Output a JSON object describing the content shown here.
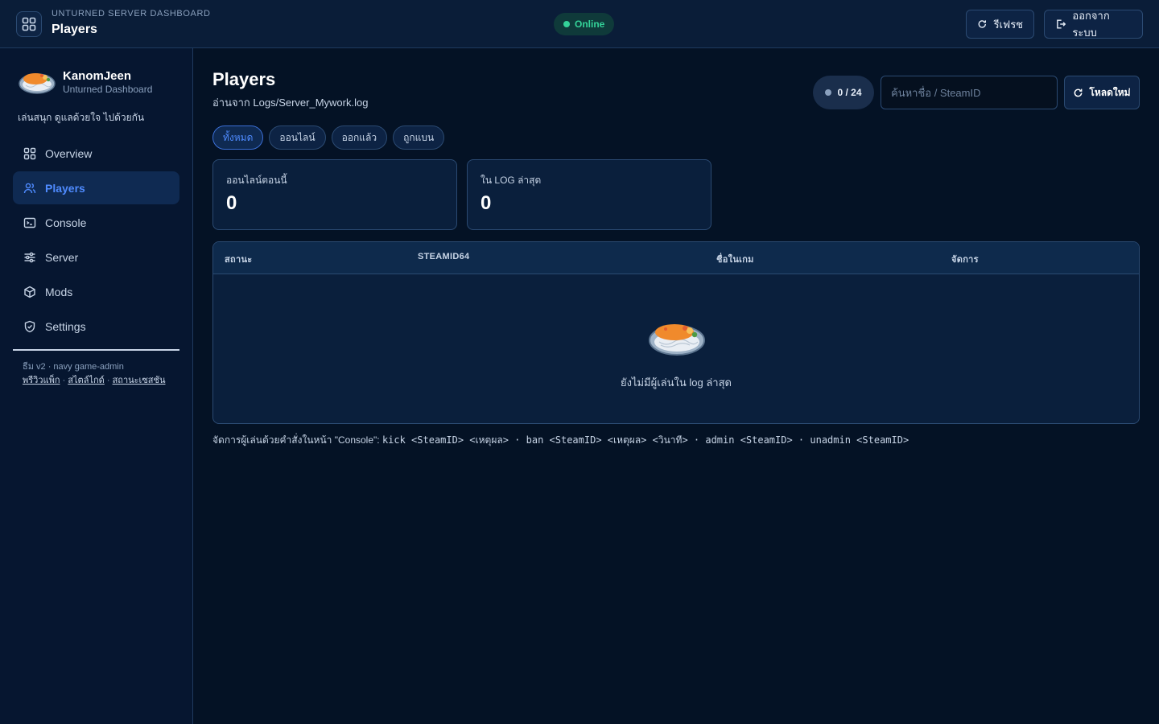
{
  "app": {
    "kicker": "UNTURNED SERVER DASHBOARD",
    "title": "Players",
    "status": "Online",
    "refresh_label": "รีเฟรช",
    "logout_label": "ออกจากระบบ"
  },
  "sidebar": {
    "brand_name": "KanomJeen",
    "brand_sub": "Unturned Dashboard",
    "tagline": "เล่นสนุก ดูแลด้วยใจ ไปด้วยกัน",
    "items": [
      {
        "label": "Overview",
        "icon": "grid-icon"
      },
      {
        "label": "Players",
        "icon": "users-icon",
        "active": true
      },
      {
        "label": "Console",
        "icon": "terminal-icon"
      },
      {
        "label": "Server",
        "icon": "sliders-icon"
      },
      {
        "label": "Mods",
        "icon": "cube-icon"
      },
      {
        "label": "Settings",
        "icon": "shield-icon"
      }
    ],
    "version": "ธีม v2 · navy game-admin",
    "links": [
      "พรีวิวแพ็ก",
      "สไตล์ไกด์",
      "สถานะเซสชัน"
    ]
  },
  "main": {
    "title": "Players",
    "subtitle": "อ่านจาก Logs/Server_Mywork.log",
    "count": "0 / 24",
    "search_placeholder": "ค้นหาชื่อ / SteamID",
    "reload_label": "โหลดใหม่",
    "tabs": [
      "ทั้งหมด",
      "ออนไลน์",
      "ออกแล้ว",
      "ถูกแบน"
    ],
    "stats": [
      {
        "label": "ออนไลน์ตอนนี้",
        "value": "0"
      },
      {
        "label": "ใน LOG ล่าสุด",
        "value": "0"
      }
    ],
    "table": {
      "columns": [
        "สถานะ",
        "STEAMID64",
        "ชื่อในเกม",
        "จัดการ"
      ],
      "empty_text": "ยังไม่มีผู้เล่นใน log ล่าสุด"
    },
    "help": {
      "prefix": "จัดการผู้เล่นด้วยคำสั่งในหน้า \"Console\": ",
      "commands": "kick <SteamID> <เหตุผล> · ban <SteamID> <เหตุผล> <วินาที> · admin <SteamID> · unadmin <SteamID>"
    }
  },
  "colors": {
    "accent": "#4f8bff",
    "online": "#34d399",
    "background": "#041225",
    "panel": "#0a1f3c"
  }
}
